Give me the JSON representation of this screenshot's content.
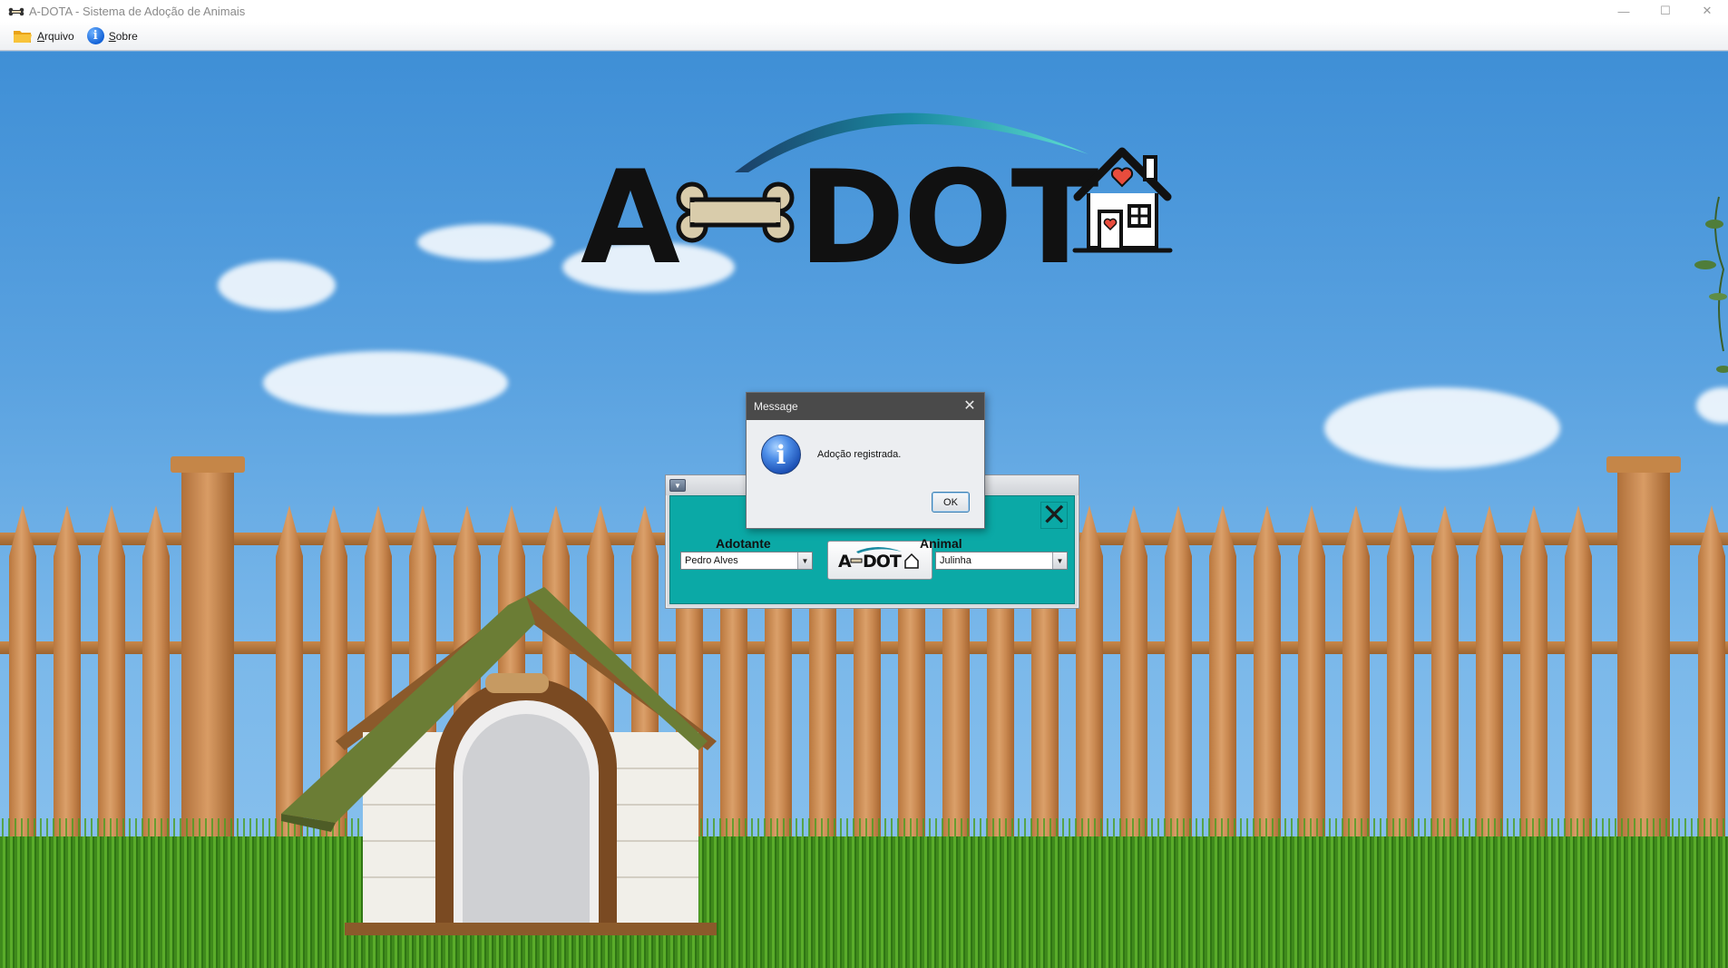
{
  "window": {
    "title": "A-DOTA - Sistema de Adoção de Animais",
    "controls": {
      "minimize": "—",
      "maximize": "☐",
      "close": "✕"
    }
  },
  "menubar": {
    "items": [
      {
        "label": "Arquivo",
        "mnemonic": "A",
        "rest": "rquivo",
        "icon": "folder-icon"
      },
      {
        "label": "Sobre",
        "mnemonic": "S",
        "rest": "obre",
        "icon": "info-icon"
      }
    ]
  },
  "logo": {
    "text_left": "A",
    "text_right": "DOT"
  },
  "adoption_frame": {
    "adotante_label": "Adotante",
    "adotante_value": "Pedro Alves",
    "animal_label": "Animal",
    "animal_value": "Julinha",
    "adopt_button_logo": "A DOT",
    "close_glyph": "✕"
  },
  "dialog": {
    "title": "Message",
    "message": "Adoção registrada.",
    "ok_label": "OK",
    "close_glyph": "✕",
    "icon": "information-icon"
  },
  "colors": {
    "form_background": "#0ba9a6",
    "sky": "#5aa2e0",
    "dialog_titlebar": "#4a4a4a"
  }
}
